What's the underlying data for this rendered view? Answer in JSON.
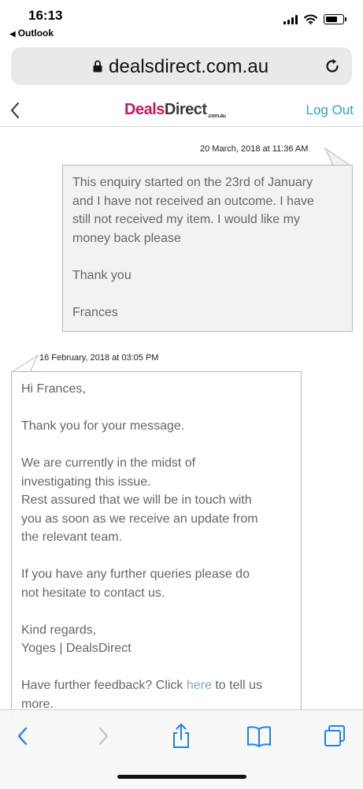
{
  "status_bar": {
    "time": "16:13",
    "back_app": "Outlook"
  },
  "browser": {
    "url": "dealsdirect.com.au"
  },
  "site_header": {
    "logo_deals": "Deals",
    "logo_direct": "Direct",
    "logo_com": ".com.au",
    "logout_label": "Log Out"
  },
  "messages": {
    "sent": {
      "date": "20 March, 2018 at 11:36 AM",
      "line1": "This enquiry started on the 23rd of January",
      "line2": "and I have not received an outcome. I have",
      "line3": "still not received my item. I would like my",
      "line4": "money back please",
      "line5": "Thank you",
      "line6": "Frances"
    },
    "received": {
      "date": "16 February, 2018 at 03:05 PM",
      "greeting": "Hi Frances,",
      "thanks": "Thank you for your message.",
      "line1": "We are currently in the midst of",
      "line2": "investigating this issue.",
      "line3": "Rest assured that we will be in touch with",
      "line4": "you as soon as we receive an update from",
      "line5": "the relevant team.",
      "line6": "If you have any further queries please do",
      "line7": "not hesitate to contact us.",
      "signoff": "Kind regards,",
      "signature": "Yoges | DealsDirect",
      "feedback_before": "Have further feedback? Click ",
      "feedback_link": "here",
      "feedback_after": " to tell us",
      "feedback_tail": "more."
    }
  },
  "icons": {
    "status": [
      "signal-icon",
      "wifi-icon",
      "battery-icon"
    ],
    "browser": [
      "lock-icon",
      "reload-icon"
    ],
    "toolbar": [
      "back-arrow-icon",
      "forward-arrow-icon",
      "share-icon",
      "bookmarks-icon",
      "tabs-icon"
    ]
  },
  "colors": {
    "brand_pink": "#c2185b",
    "link_blue": "#2aa1d6",
    "safari_blue": "#1a82fb"
  }
}
